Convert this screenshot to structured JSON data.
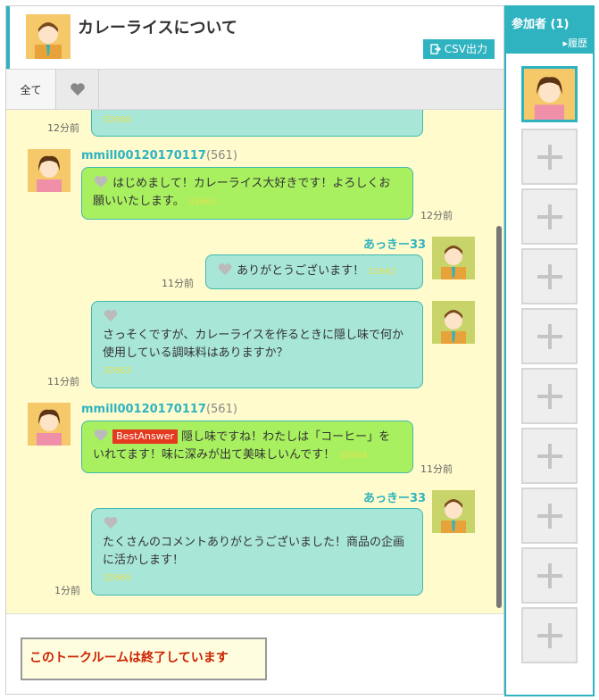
{
  "room": {
    "title": "カレーライスについて",
    "csv_label": "CSV出力"
  },
  "tabs": {
    "all": "全て"
  },
  "messages": [
    {
      "number": "32660",
      "time": "12分前"
    },
    {
      "user": "mmill00120170117",
      "count": "(561)",
      "text": "はじめまして！カレーライス大好きです！よろしくお願いいたします。",
      "number": "32661",
      "time": "12分前"
    },
    {
      "user": "あっきー33",
      "text": "ありがとうございます！",
      "number": "32662",
      "time": "11分前"
    },
    {
      "text": "さっそくですが、カレーライスを作るときに隠し味で何か使用している調味料はありますか？",
      "number": "32663",
      "time": "11分前"
    },
    {
      "user": "mmill00120170117",
      "count": "(561)",
      "badge": "BestAnswer",
      "text": "隠し味ですね！わたしは「コーヒー」をいれてます！味に深みが出て美味しいんです！",
      "number": "32664",
      "time": "11分前"
    },
    {
      "user": "あっきー33",
      "text": "たくさんのコメントありがとうございました！商品の企画に活かします！",
      "number": "32665",
      "time": "1分前"
    }
  ],
  "footer": {
    "ended": "このトークルームは終了しています"
  },
  "sidebar": {
    "title": "参加者 (1)",
    "history": "▸履歴"
  },
  "colors": {
    "accent": "#2fb3c1",
    "chat_bg": "#fffbcc",
    "green_bubble": "#a8f060",
    "teal_bubble": "#a8e6d8",
    "ended_text": "#cc2200"
  }
}
